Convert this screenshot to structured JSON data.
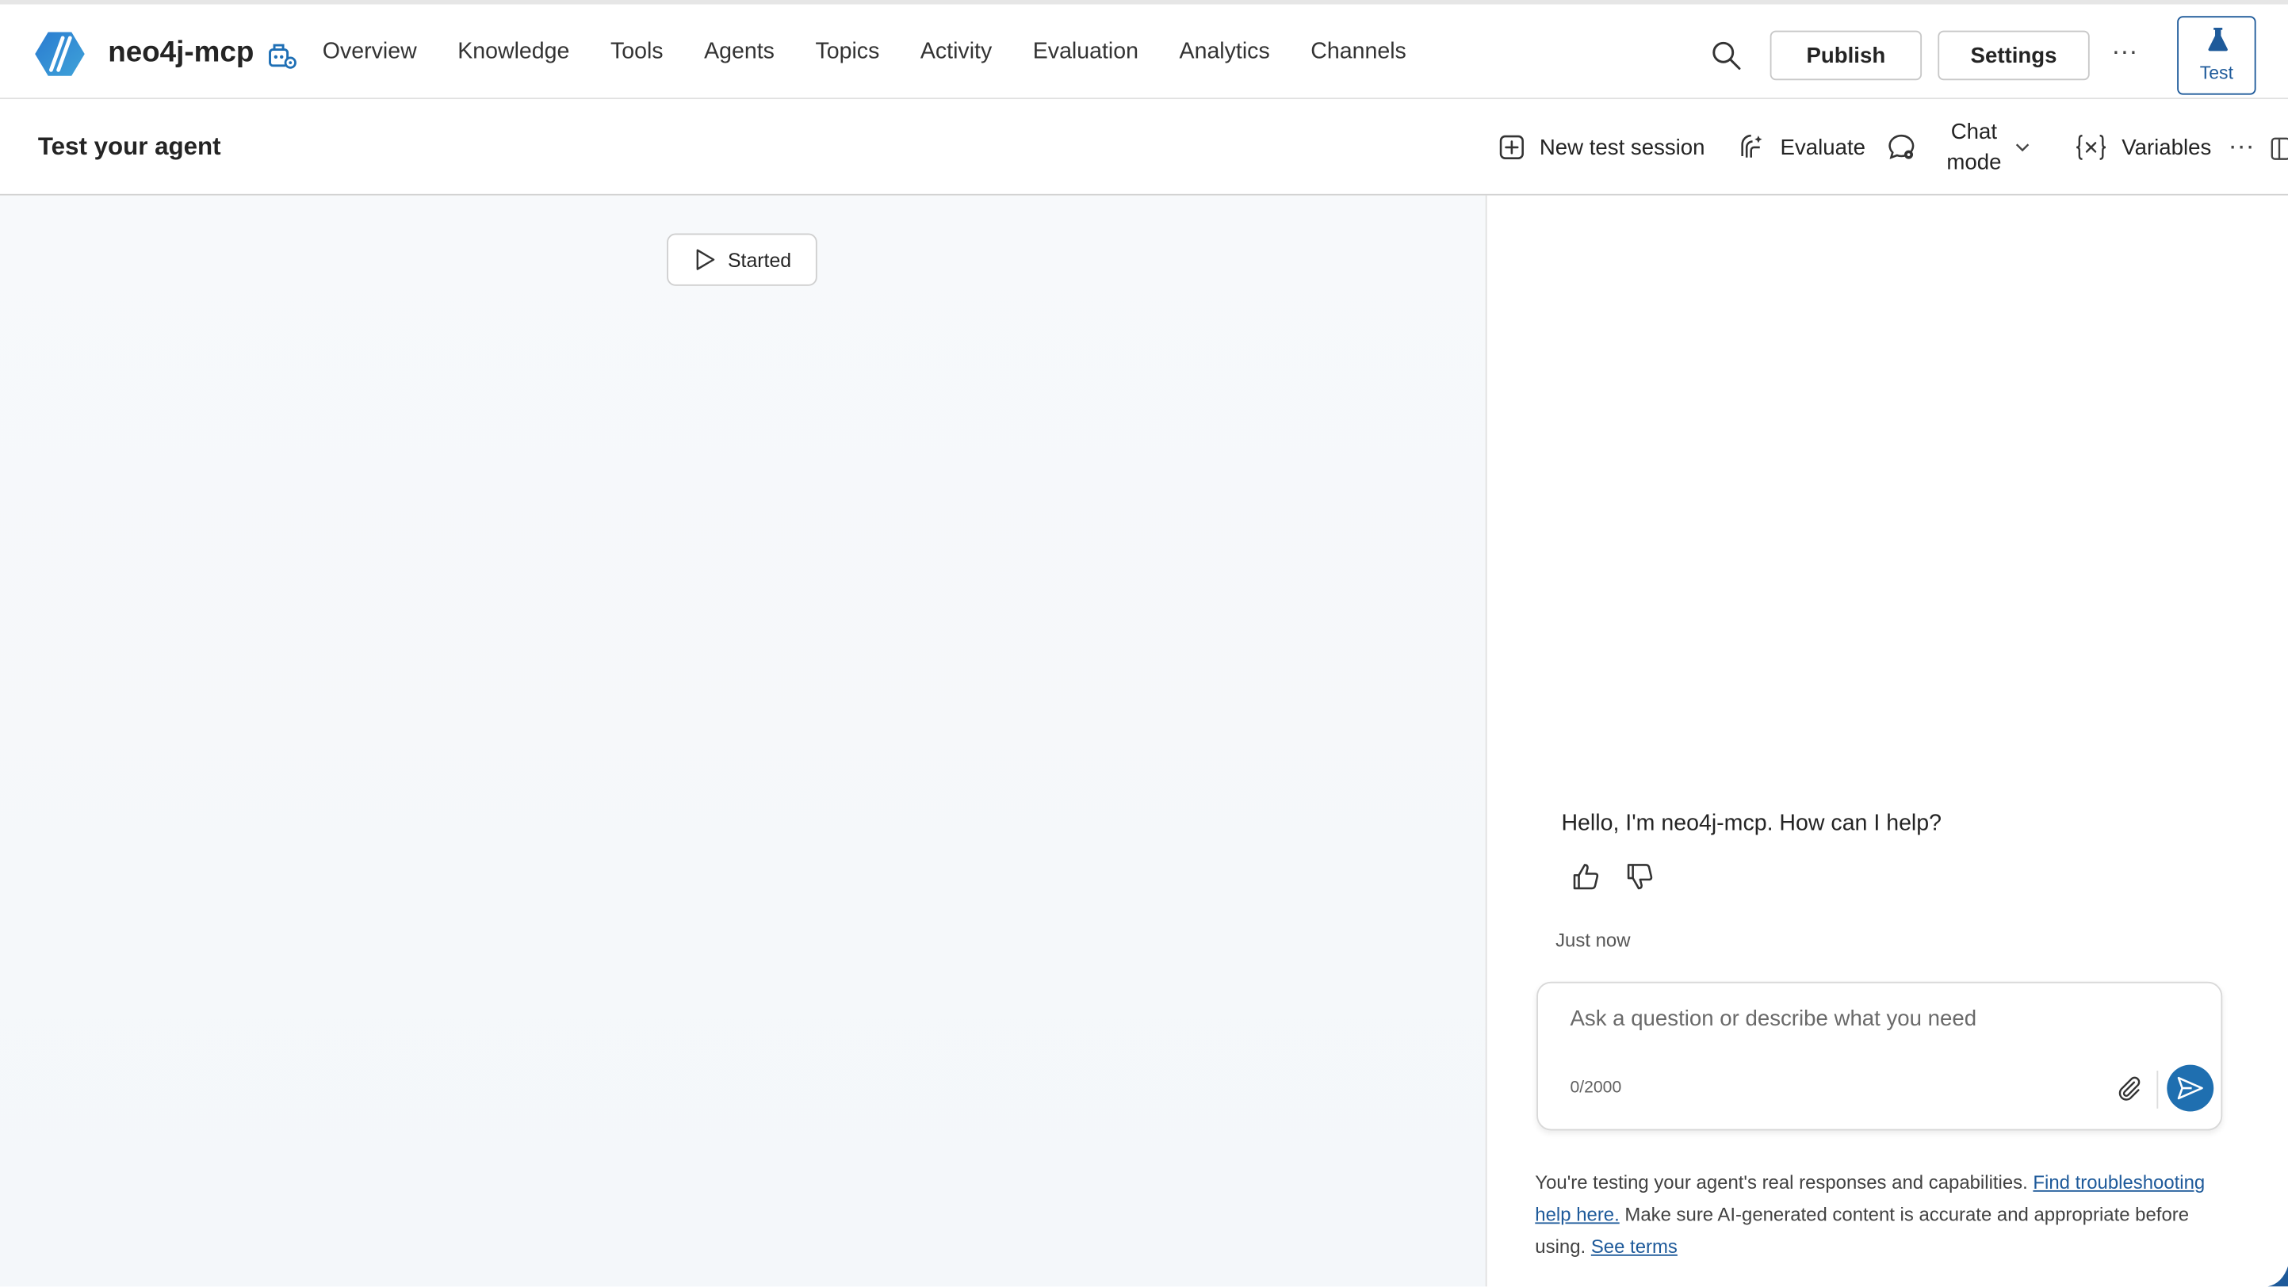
{
  "header": {
    "app_name": "neo4j-mcp",
    "nav": [
      "Overview",
      "Knowledge",
      "Tools",
      "Agents",
      "Topics",
      "Activity",
      "Evaluation",
      "Analytics",
      "Channels"
    ],
    "publish_label": "Publish",
    "settings_label": "Settings",
    "more_label": "···",
    "test_label": "Test"
  },
  "subbar": {
    "title": "Test your agent",
    "new_session_label": "New test session",
    "evaluate_label": "Evaluate",
    "chat_mode_line1": "Chat",
    "chat_mode_line2": "mode",
    "variables_label": "Variables",
    "more_label": "···"
  },
  "canvas": {
    "started_label": "Started"
  },
  "chat": {
    "greeting": "Hello, I'm neo4j-mcp. How can I help?",
    "timestamp": "Just now",
    "input_placeholder": "Ask a question or describe what you need",
    "counter": "0/2000",
    "disclaimer_pre": "You're testing your agent's real responses and capabilities. ",
    "troubleshoot_link": "Find troubleshooting help here.",
    "disclaimer_mid": " Make sure AI-generated content is accurate and appropriate before using. ",
    "terms_link": "See terms"
  },
  "colors": {
    "accent": "#1f6fb0",
    "link": "#1e5a9a"
  }
}
